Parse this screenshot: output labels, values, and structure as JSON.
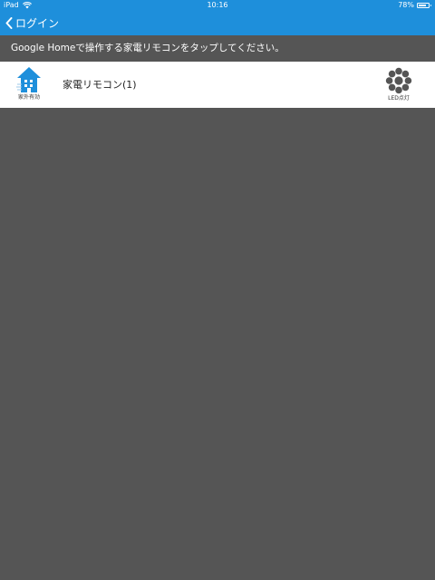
{
  "status_bar": {
    "device": "iPad",
    "time": "10:16",
    "battery_text": "78%",
    "battery_level": 0.78
  },
  "nav": {
    "back_label": "ログイン"
  },
  "instruction": "Google Homeで操作する家電リモコンをタップしてください。",
  "remotes": [
    {
      "name": "家電リモコン(1)",
      "home_status_label": "家外有効",
      "led_label": "LED点灯"
    }
  ],
  "colors": {
    "brand_blue": "#1e8fdb",
    "home_icon": "#1e8fdb",
    "background": "#555555",
    "led_icon": "#555555"
  }
}
